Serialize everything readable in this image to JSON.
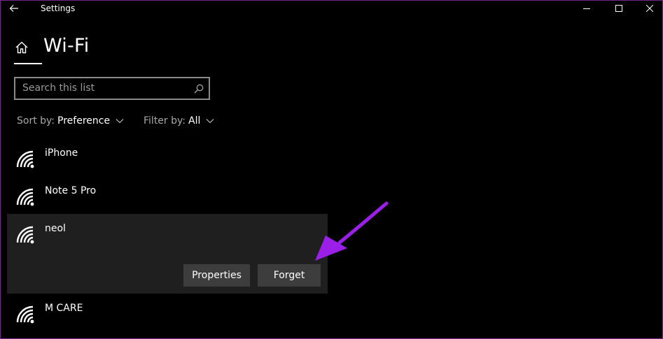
{
  "window": {
    "title": "Settings"
  },
  "header": {
    "title": "Wi-Fi"
  },
  "search": {
    "placeholder": "Search this list"
  },
  "sort": {
    "label": "Sort by:",
    "value": "Preference"
  },
  "filter": {
    "label": "Filter by:",
    "value": "All"
  },
  "networks": [
    {
      "name": "iPhone"
    },
    {
      "name": "Note 5 Pro"
    },
    {
      "name": "neol",
      "selected": true
    },
    {
      "name": "M CARE"
    }
  ],
  "actions": {
    "properties": "Properties",
    "forget": "Forget"
  },
  "colors": {
    "background": "#000000",
    "panel": "#1f1f1f",
    "button": "#3d3d3d",
    "arrow": "#9b1fe8"
  }
}
